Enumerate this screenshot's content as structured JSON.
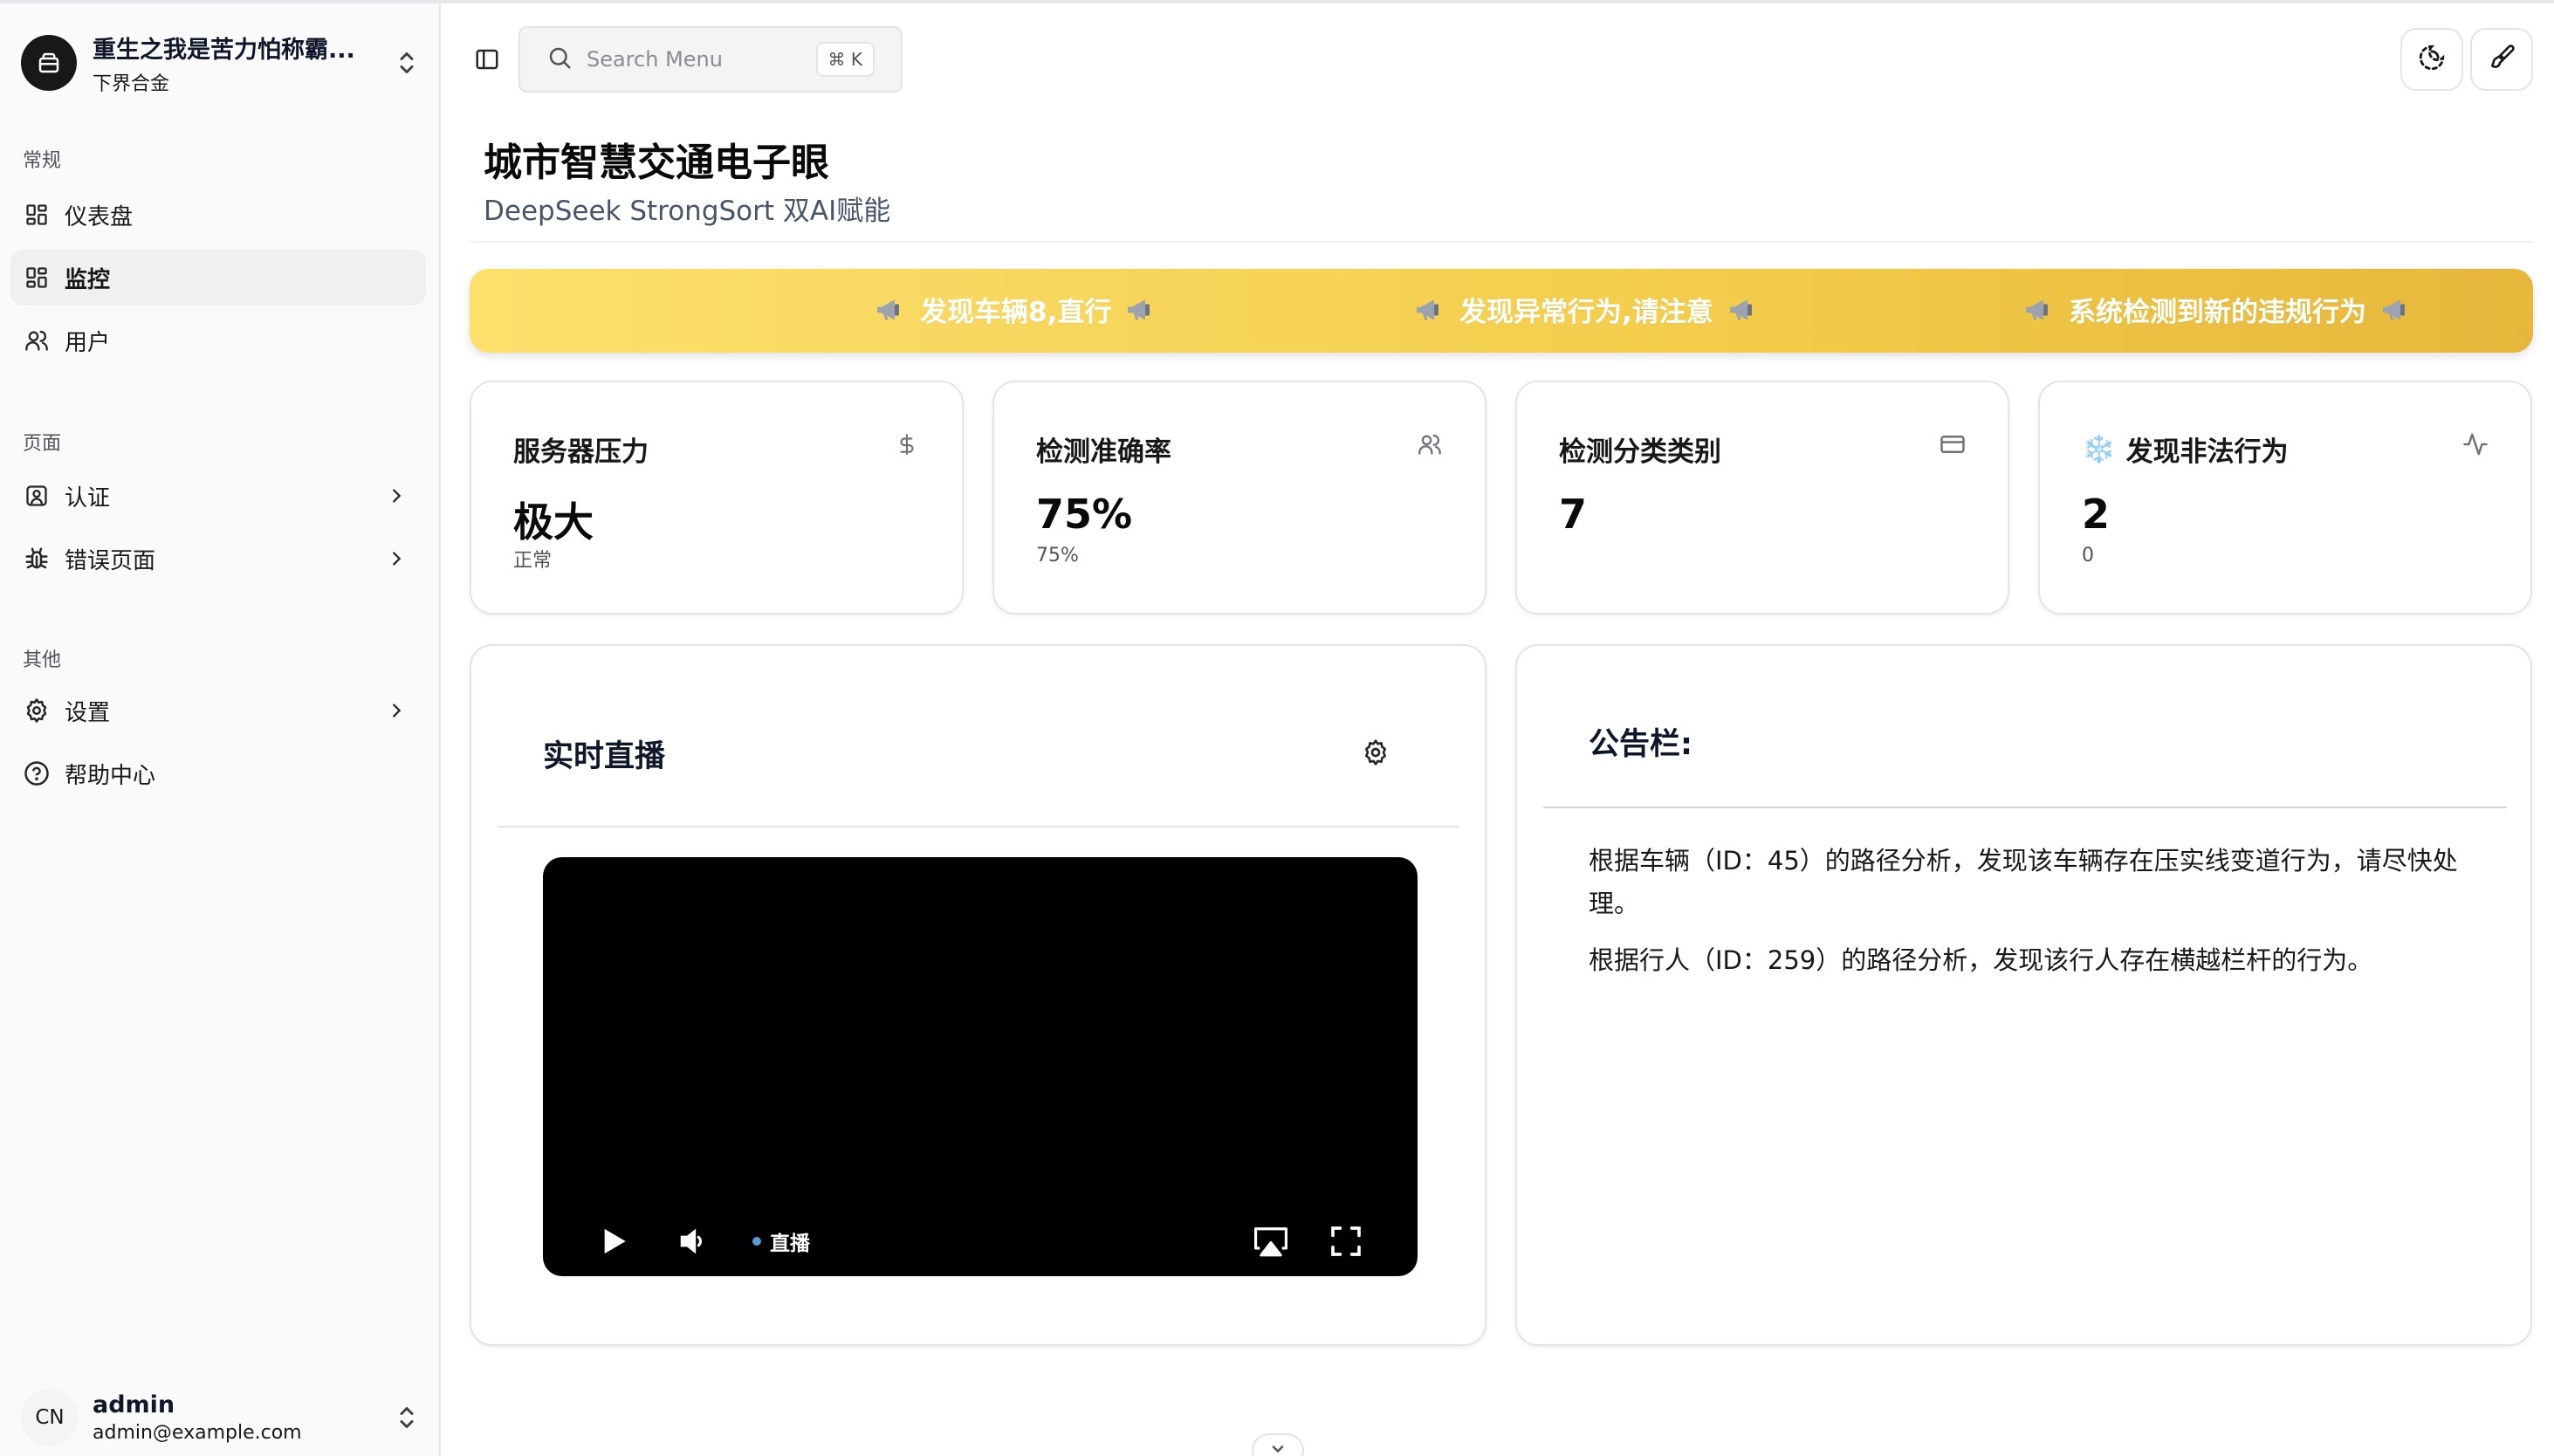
{
  "sidebar": {
    "team": {
      "name": "重生之我是苦力怕称霸...",
      "plan": "下界合金"
    },
    "groups": [
      {
        "label": "常规",
        "items": [
          {
            "label": "仪表盘",
            "icon": "layout-grid-icon"
          },
          {
            "label": "监控",
            "icon": "layout-grid-icon",
            "active": true
          },
          {
            "label": "用户",
            "icon": "users-icon"
          }
        ]
      },
      {
        "label": "页面",
        "items": [
          {
            "label": "认证",
            "icon": "user-square-icon"
          },
          {
            "label": "错误页面",
            "icon": "bug-icon"
          }
        ]
      },
      {
        "label": "其他",
        "items": [
          {
            "label": "设置",
            "icon": "gear-icon"
          },
          {
            "label": "帮助中心",
            "icon": "help-circle-icon"
          }
        ]
      }
    ],
    "user": {
      "initials": "CN",
      "name": "admin",
      "email": "admin@example.com"
    }
  },
  "header": {
    "search_placeholder": "Search Menu",
    "search_shortcut": "⌘ K"
  },
  "page": {
    "title": "城市智慧交通电子眼",
    "subtitle": "DeepSeek StrongSort 双AI赋能"
  },
  "marquee": [
    "发现车辆8,直行",
    "发现异常行为,请注意",
    "系统检测到新的违规行为"
  ],
  "stats": [
    {
      "title": "服务器压力",
      "value": "极大",
      "sub": "正常",
      "icon": "dollar-icon"
    },
    {
      "title": "检测准确率",
      "value": "75%",
      "sub": "75%",
      "icon": "users-icon"
    },
    {
      "title": "检测分类类别",
      "value": "7",
      "sub": "",
      "icon": "credit-card-icon"
    },
    {
      "title": "发现非法行为",
      "value": "2",
      "sub": "0",
      "icon": "activity-icon",
      "prefix": "❄️"
    }
  ],
  "live": {
    "title": "实时直播",
    "badge": "直播"
  },
  "notice": {
    "title": "公告栏:",
    "lines": [
      "根据车辆（ID：45）的路径分析，发现该车辆存在压实线变道行为，请尽快处理。",
      "根据行人（ID：259）的路径分析，发现该行人存在横越栏杆的行为。"
    ]
  }
}
